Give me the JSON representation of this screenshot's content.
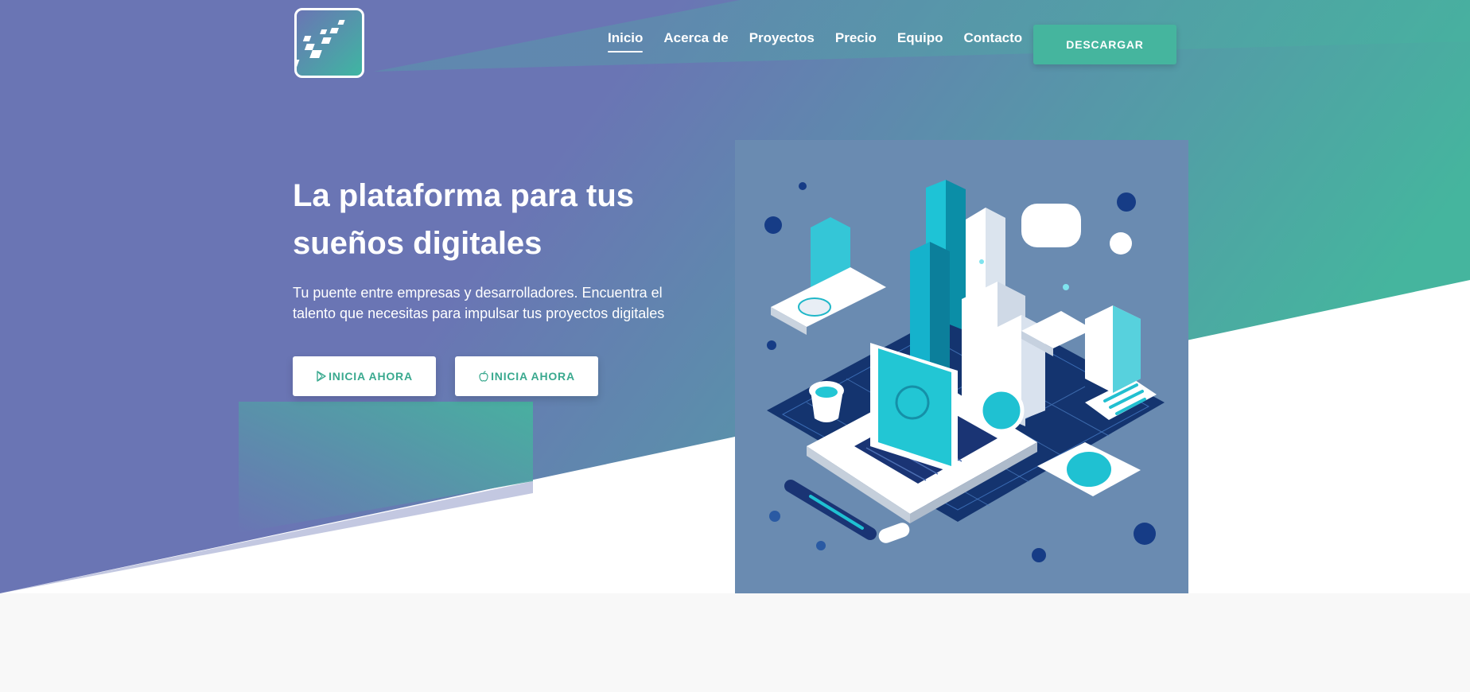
{
  "colors": {
    "hero_purple": "#6a75b4",
    "hero_teal": "#45b59e",
    "accent": "#45b59e",
    "cta_text": "#3aa98f",
    "illustration_bg": "#6a8bb1",
    "page_bg": "#f8f8f8"
  },
  "logo": {
    "icon": "checkered-flag-icon"
  },
  "nav": {
    "items": [
      {
        "label": "Inicio",
        "active": true
      },
      {
        "label": "Acerca de",
        "active": false
      },
      {
        "label": "Proyectos",
        "active": false
      },
      {
        "label": "Precio",
        "active": false
      },
      {
        "label": "Equipo",
        "active": false
      },
      {
        "label": "Contacto",
        "active": false
      }
    ],
    "download_label": "DESCARGAR"
  },
  "hero": {
    "title_line1": "La plataforma para tus",
    "title_line2": "sueños digitales",
    "subtitle_line1": "Tu puente entre empresas y desarrolladores. Encuentra el",
    "subtitle_line2": "talento que necesitas para impulsar tus proyectos digitales",
    "cta_primary": {
      "label": "INICIA AHORA",
      "icon": "google-play-icon"
    },
    "cta_secondary": {
      "label": "INICIA AHORA",
      "icon": "apple-icon"
    }
  },
  "illustration": {
    "description_icon": "isometric-tech-city-illustration"
  }
}
